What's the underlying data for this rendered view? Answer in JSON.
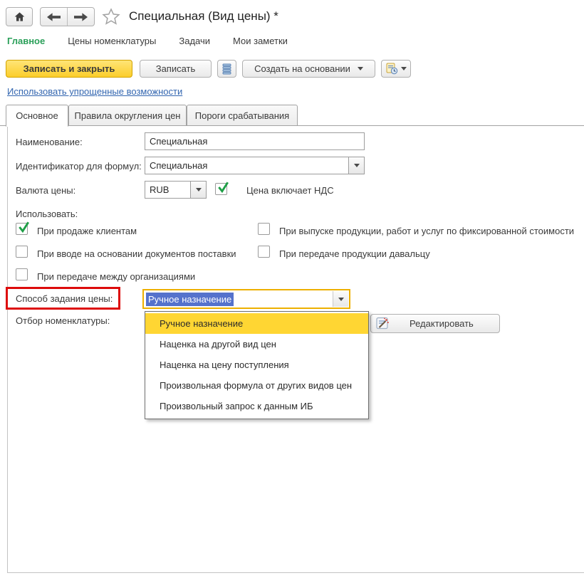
{
  "window": {
    "title": "Специальная (Вид цены) *"
  },
  "menu": {
    "items": [
      {
        "label": "Главное",
        "active": true
      },
      {
        "label": "Цены номенклатуры",
        "active": false
      },
      {
        "label": "Задачи",
        "active": false
      },
      {
        "label": "Мои заметки",
        "active": false
      }
    ]
  },
  "toolbar": {
    "save_close_label": "Записать и закрыть",
    "save_label": "Записать",
    "create_based_on_label": "Создать на основании",
    "icons": [
      "stack-icon",
      "document-clock-icon"
    ]
  },
  "simplified_link": "Использовать упрощенные возможности",
  "tabs": [
    {
      "label": "Основное",
      "active": true
    },
    {
      "label": "Правила округления цен",
      "active": false
    },
    {
      "label": "Пороги срабатывания",
      "active": false
    }
  ],
  "form": {
    "name_label": "Наименование:",
    "name_value": "Специальная",
    "identifier_label": "Идентификатор для формул:",
    "identifier_value": "Специальная",
    "currency_label": "Валюта цены:",
    "currency_value": "RUB",
    "vat_checkbox_label": "Цена включает НДС",
    "vat_checked": true,
    "use_label": "Использовать:",
    "usage_checkboxes": [
      {
        "label": "При продаже клиентам",
        "checked": true
      },
      {
        "label": "При выпуске продукции, работ и услуг по фиксированной стоимости",
        "checked": false
      },
      {
        "label": "При вводе на основании документов поставки",
        "checked": false
      },
      {
        "label": "При передаче продукции давальцу",
        "checked": false
      },
      {
        "label": "При передаче между организациями",
        "checked": false
      }
    ],
    "price_method_label": "Способ задания цены:",
    "price_method_value": "Ручное назначение",
    "selection_label": "Отбор номенклатуры:",
    "edit_button_label": "Редактировать"
  },
  "price_method_dropdown": {
    "items": [
      {
        "label": "Ручное назначение",
        "highlighted": true
      },
      {
        "label": "Наценка на другой вид цен",
        "highlighted": false
      },
      {
        "label": "Наценка на цену поступления",
        "highlighted": false
      },
      {
        "label": "Произвольная формула от других видов цен",
        "highlighted": false
      },
      {
        "label": "Произвольный запрос к данным ИБ",
        "highlighted": false
      }
    ]
  },
  "colors": {
    "accent_yellow": "#FBCE2B",
    "highlight_yellow": "#FFD633",
    "active_menu_green": "#2BA05A",
    "check_green": "#1E9E46",
    "link_blue": "#3366B0",
    "selection_blue": "#5572CC",
    "focus_border_orange": "#EDB000",
    "annotation_red": "#DD0B0B"
  }
}
